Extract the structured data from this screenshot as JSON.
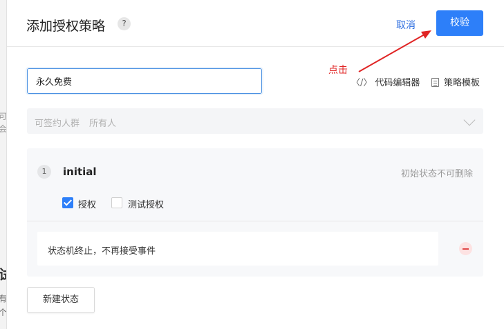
{
  "background": {
    "fragment_1": "可",
    "fragment_2": "会",
    "fragment_3": "试",
    "fragment_4": "有",
    "fragment_5": "个"
  },
  "header": {
    "title": "添加授权策略",
    "help_icon_glyph": "?",
    "cancel_label": "取消",
    "verify_label": "校验"
  },
  "annotation": {
    "text": "点击",
    "color": "#e02424"
  },
  "form": {
    "policy_name_value": "永久免费",
    "code_editor_icon": "〈/〉",
    "code_editor_label": "代码编辑器",
    "template_label": "策略模板",
    "signer_label": "可签约人群",
    "signer_value": "所有人"
  },
  "state": {
    "index": "1",
    "name": "initial",
    "hint": "初始状态不可删除",
    "options": [
      {
        "label": "授权",
        "checked": true
      },
      {
        "label": "测试授权",
        "checked": false
      }
    ],
    "end_text": "状态机终止，不再接受事件"
  },
  "actions": {
    "new_state_label": "新建状态"
  },
  "colors": {
    "primary": "#2d7ff9",
    "danger": "#e04848"
  }
}
